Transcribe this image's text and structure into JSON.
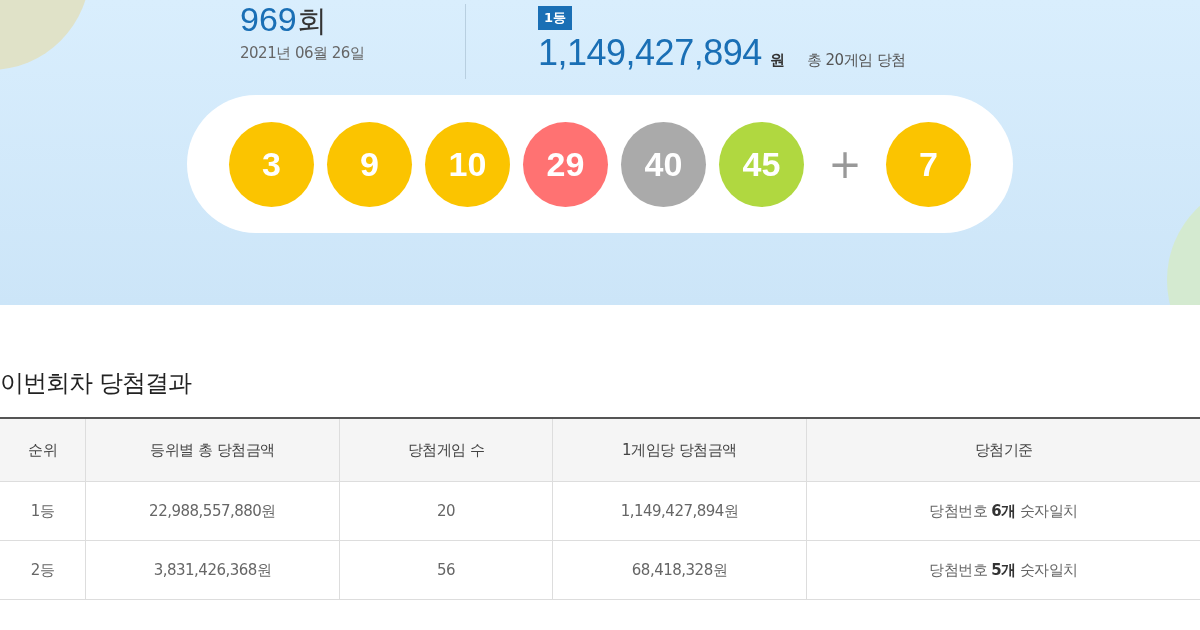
{
  "draw": {
    "round_number": "969",
    "round_suffix": "회",
    "date": "2021년 06월 26일",
    "rank_badge": "1등",
    "prize_amount": "1,149,427,894",
    "prize_unit": "원",
    "winners_summary": "총 20게임 당첨",
    "balls": [
      {
        "number": "3",
        "color": "#fbc400"
      },
      {
        "number": "9",
        "color": "#fbc400"
      },
      {
        "number": "10",
        "color": "#fbc400"
      },
      {
        "number": "29",
        "color": "#ff7272"
      },
      {
        "number": "40",
        "color": "#aaaaaa"
      },
      {
        "number": "45",
        "color": "#b0d840"
      }
    ],
    "plus": "+",
    "bonus_ball": {
      "number": "7",
      "color": "#fbc400"
    }
  },
  "results": {
    "title": "이번회차 당첨결과",
    "columns": [
      "순위",
      "등위별 총 당첨금액",
      "당첨게임 수",
      "1게임당 당첨금액",
      "당첨기준"
    ],
    "rows": [
      [
        "1등",
        "22,988,557,880원",
        "20",
        "1,149,427,894원",
        "당첨번호 **6개** 숫자일치"
      ],
      [
        "2등",
        "3,831,426,368원",
        "56",
        "68,418,328원",
        "당첨번호 **5개** 숫자일치"
      ]
    ]
  }
}
